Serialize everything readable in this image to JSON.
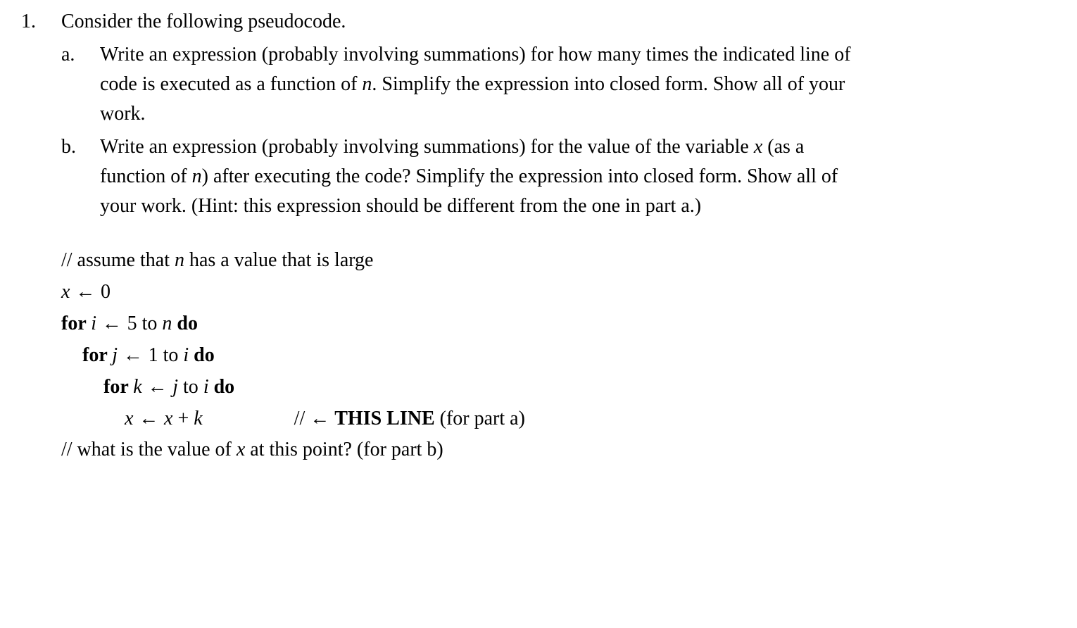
{
  "problem": {
    "number": "1.",
    "intro": "Consider the following pseudocode.",
    "subA": {
      "letter": "a.",
      "text_part1": "Write an expression (probably involving summations) for how many times the indicated line of code is executed as a function of ",
      "text_var": "n",
      "text_part2": ". Simplify the expression into closed form. Show all of your work."
    },
    "subB": {
      "letter": "b.",
      "text_part1": "Write an expression (probably involving summations) for the value of the variable ",
      "text_var1": "x",
      "text_part2": " (as a function of ",
      "text_var2": "n",
      "text_part3": ") after executing the code? Simplify the expression into closed form. Show all of your work. (Hint: this expression should be different from the one in part a.)"
    }
  },
  "code": {
    "line0_a": "// assume that ",
    "line0_var": "n",
    "line0_b": " has a value that is large",
    "line1_var": "x",
    "line1_arrow": " ← ",
    "line1_val": "0",
    "line2_for": "for ",
    "line2_var": "i",
    "line2_arrow": " ← ",
    "line2_from": "5 to ",
    "line2_to": "n",
    "line2_do": " do",
    "line3_for": "for ",
    "line3_var": "j",
    "line3_arrow": " ← ",
    "line3_from": "1 to ",
    "line3_to": "i",
    "line3_do": " do",
    "line4_for": "for ",
    "line4_var": "k",
    "line4_arrow": " ← ",
    "line4_from": "j",
    "line4_mid": " to ",
    "line4_to": "i",
    "line4_do": " do",
    "line5_var1": "x",
    "line5_arrow": " ← ",
    "line5_var2": "x",
    "line5_plus": " + ",
    "line5_var3": "k",
    "line5_comment_a": "// ← ",
    "line5_comment_b": "THIS LINE",
    "line5_comment_c": " (for part a)",
    "line6_a": "// what is the value of ",
    "line6_var": "x",
    "line6_b": " at this point? (for part b)"
  }
}
